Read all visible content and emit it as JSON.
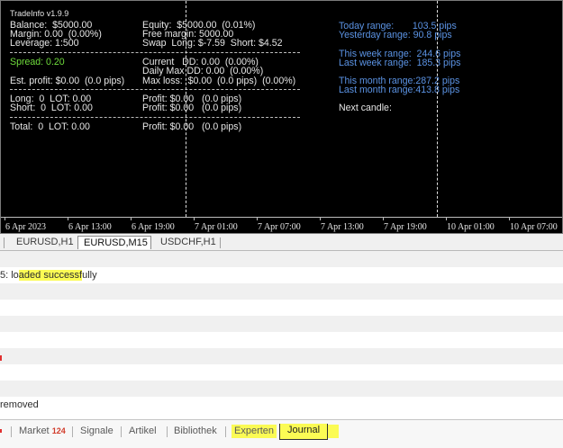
{
  "chart": {
    "title": "TradeInfo v1.9.9",
    "col1": {
      "balance": "Balance:  $5000.00",
      "margin": "Margin: 0.00  (0.00%)",
      "leverage": "Leverage: 1:500",
      "spread": "Spread: 0.20",
      "est_profit": "Est. profit: $0.00  (0.0 pips)",
      "long": "Long:  0  LOT: 0.00",
      "short": "Short:  0  LOT: 0.00",
      "total": "Total:  0  LOT: 0.00"
    },
    "col2": {
      "equity": "Equity:  $5000.00  (0.01%)",
      "free_margin": "Free margin: 5000.00",
      "swap": "Swap  Long: $-7.59  Short: $4.52",
      "current_dd": "Current   DD: 0.00  (0.00%)",
      "daily_max_dd": "Daily Max DD: 0.00  (0.00%)",
      "max_loss": "Max loss:  $0.00  (0.0 pips)  (0.00%)",
      "profit_long": "Profit: $0.00   (0.0 pips)",
      "profit_short": "Profit: $0.00   (0.0 pips)",
      "profit_total": "Profit: $0.00   (0.0 pips)"
    },
    "col3": {
      "today_range": "Today range:       103.5 pips",
      "yesterday_range": "Yesterday range: 90.8 pips",
      "this_week_range": "This week range:  244.6 pips",
      "last_week_range": "Last week range:  185.3 pips",
      "this_month_range": "This month range:287.2 pips",
      "last_month_range": "Last month range:413.8 pips",
      "next_candle": "Next candle:"
    },
    "x_labels": [
      "6 Apr 2023",
      "6 Apr 13:00",
      "6 Apr 19:00",
      "7 Apr 01:00",
      "7 Apr 07:00",
      "7 Apr 13:00",
      "7 Apr 19:00",
      "10 Apr 01:00",
      "10 Apr 07:00"
    ]
  },
  "chart_tabs": [
    "EURUSD,H1",
    "EURUSD,M15",
    "USDCHF,H1"
  ],
  "log": {
    "loaded_prefix": "5: lo",
    "loaded_highlight": "aded successf",
    "loaded_suffix": "ully",
    "removed": "removed"
  },
  "bottom_tabs": {
    "market": "Market",
    "market_count": "124",
    "signale": "Signale",
    "artikel": "Artikel",
    "bibliothek": "Bibliothek",
    "experten": "Experten",
    "journal": "Journal"
  },
  "colors": {
    "chart_bg": "#000000",
    "spread_green": "#6fdc3c",
    "range_blue": "#5b93e4",
    "highlight_yellow": "#fbfb54",
    "count_red": "#d13b2a"
  }
}
